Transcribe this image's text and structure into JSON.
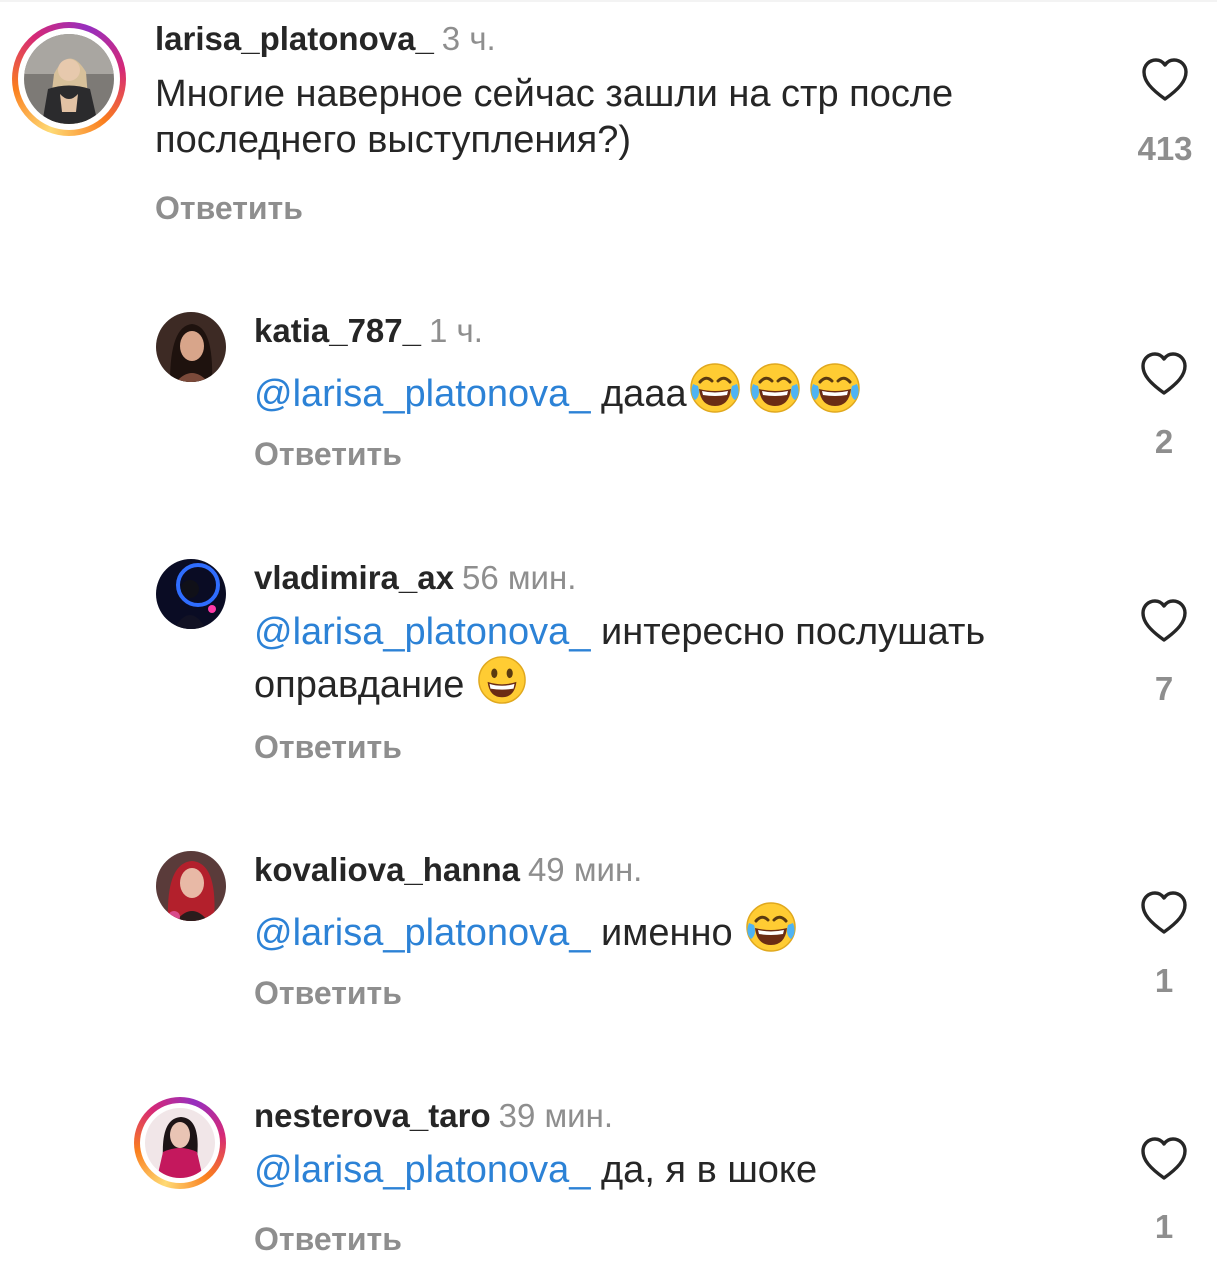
{
  "comments": [
    {
      "username": "larisa_platonova_",
      "time": "3 ч.",
      "mention": "",
      "text": "Многие наверное сейчас зашли на стр после последнего выступления?)",
      "reply_label": "Ответить",
      "likes": "413",
      "emoji": "",
      "has_story_ring": true
    },
    {
      "username": "katia_787_",
      "time": "1 ч.",
      "mention": "@larisa_platonova_",
      "text": " дааа",
      "reply_label": "Ответить",
      "likes": "2",
      "emoji": "face-with-tears-of-joy x3",
      "has_story_ring": false
    },
    {
      "username": "vladimira_ax",
      "time": "56 мин.",
      "mention": "@larisa_platonova_",
      "text": " интересно послушать оправдание ",
      "reply_label": "Ответить",
      "likes": "7",
      "emoji": "grinning-face",
      "has_story_ring": false
    },
    {
      "username": "kovaliova_hanna",
      "time": "49 мин.",
      "mention": "@larisa_platonova_",
      "text": " именно ",
      "reply_label": "Ответить",
      "likes": "1",
      "emoji": "face-with-tears-of-joy",
      "has_story_ring": false
    },
    {
      "username": "nesterova_taro",
      "time": "39 мин.",
      "mention": "@larisa_platonova_",
      "text": " да, я в шоке",
      "reply_label": "Ответить",
      "likes": "1",
      "emoji": "",
      "has_story_ring": true
    }
  ],
  "colors": {
    "mention": "#2c82d6",
    "secondary_text": "#8e8e8e",
    "primary_text": "#262626"
  }
}
